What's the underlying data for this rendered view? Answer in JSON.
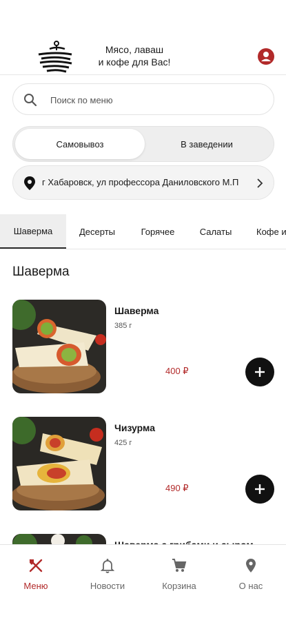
{
  "header": {
    "tagline_line1": "Мясо, лаваш",
    "tagline_line2": "и кофе для Вас!",
    "logo_icon": "grill-spit-logo",
    "profile_icon": "profile-icon"
  },
  "search": {
    "placeholder": "Поиск по меню",
    "value": ""
  },
  "order_mode": {
    "options": [
      "Самовывоз",
      "В заведении"
    ],
    "selected": "Самовывоз"
  },
  "address": {
    "text": "г Хабаровск, ул профессора Даниловского М.П"
  },
  "categories": {
    "items": [
      "Шаверма",
      "Десерты",
      "Горячее",
      "Салаты",
      "Кофе и"
    ],
    "active": "Шаверма"
  },
  "section": {
    "title": "Шаверма"
  },
  "products": [
    {
      "name": "Шаверма",
      "weight": "385 г",
      "price": "400 ₽"
    },
    {
      "name": "Чизурма",
      "weight": "425 г",
      "price": "490 ₽"
    },
    {
      "name": "Шаверма с грибами и сыром",
      "weight": "",
      "price": ""
    }
  ],
  "bottom_nav": {
    "items": [
      {
        "label": "Меню",
        "icon": "fork-knife-icon"
      },
      {
        "label": "Новости",
        "icon": "bell-icon"
      },
      {
        "label": "Корзина",
        "icon": "cart-icon"
      },
      {
        "label": "О нас",
        "icon": "location-pin-icon"
      }
    ],
    "active": "Меню"
  },
  "colors": {
    "accent": "#b22a2a",
    "text": "#1a1a1a",
    "add_button": "#111111"
  }
}
